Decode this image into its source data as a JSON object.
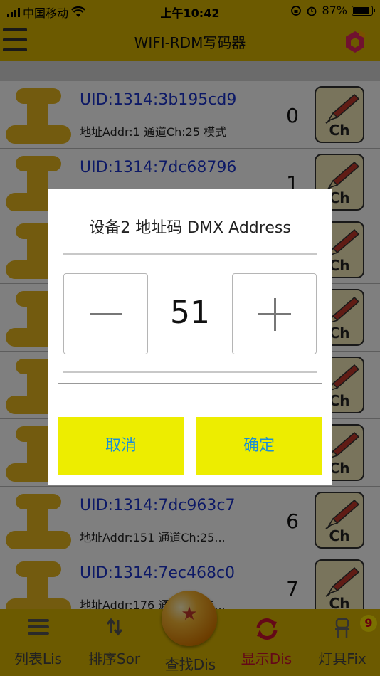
{
  "status_bar": {
    "carrier": "中国移动",
    "time": "上午10:42",
    "battery_level": "87%",
    "battery_fraction": 0.87
  },
  "header": {
    "title": "WIFI-RDM写码器",
    "menu_icon": "hamburger-menu-icon",
    "logo_icon": "hexagon-logo-icon"
  },
  "list": {
    "rows": [
      {
        "uid": "UID:1314:3b195cd9",
        "detail": "地址Addr:1  通道Ch:25  模式",
        "index": "0",
        "button_label": "Ch"
      },
      {
        "uid": "UID:1314:7dc68796",
        "detail": "",
        "index": "1",
        "button_label": "Ch"
      },
      {
        "uid": "",
        "detail": "",
        "index": "",
        "button_label": "Ch"
      },
      {
        "uid": "",
        "detail": "",
        "index": "",
        "button_label": "Ch"
      },
      {
        "uid": "",
        "detail": "",
        "index": "",
        "button_label": "Ch"
      },
      {
        "uid": "",
        "detail": "",
        "index": "",
        "button_label": "Ch"
      },
      {
        "uid": "UID:1314:7dc963c7",
        "detail": "地址Addr:151  通道Ch:25...",
        "index": "6",
        "button_label": "Ch"
      },
      {
        "uid": "UID:1314:7ec468c0",
        "detail": "地址Addr:176  通道Ch:25...",
        "index": "7",
        "button_label": "Ch"
      }
    ]
  },
  "dialog": {
    "title": "设备2 地址码 DMX Address",
    "value": "51",
    "minus_icon": "minus-icon",
    "plus_icon": "plus-icon",
    "cancel_label": "取消",
    "confirm_label": "确定"
  },
  "tabbar": {
    "tabs": [
      {
        "label": "列表Lis",
        "icon": "list-icon"
      },
      {
        "label": "排序Sor",
        "icon": "sort-icon"
      },
      {
        "label": "查找Dis",
        "icon": "dragon-ball-icon"
      },
      {
        "label": "显示Dis",
        "icon": "refresh-icon",
        "active": true
      },
      {
        "label": "灯具Fix",
        "icon": "fixture-icon"
      }
    ],
    "badge_count": "9"
  },
  "colors": {
    "accent": "#d9b400",
    "uid_text": "#1a33cc",
    "dialog_button": "#eded00",
    "dialog_button_text": "#1a8fd6",
    "active_tab": "#c8102e"
  }
}
